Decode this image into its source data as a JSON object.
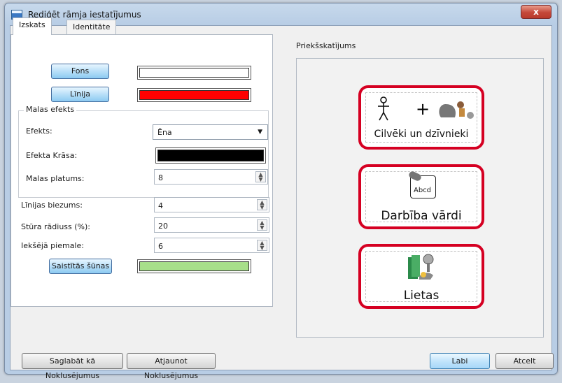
{
  "window": {
    "title": "Rediģēt rāmja iestatījumus",
    "close_label": "x"
  },
  "tabs": [
    {
      "label": "Izskats"
    },
    {
      "label": "Identitāte"
    }
  ],
  "appearance": {
    "fons_label": "Fons",
    "linija_label": "Līnija",
    "frame_color": "#ffffff",
    "line_color": "#ff0000",
    "effect_group_title": "Malas efekts",
    "effect_label": "Efekts:",
    "effect_value": "Ēna",
    "effect_color_label": "Efekta Krāsa:",
    "effect_color": "#000000",
    "edge_width_label": "Malas platums:",
    "edge_width_value": "8",
    "line_thickness_label": "Līnijas biezums:",
    "line_thickness_value": "4",
    "corner_radius_label": "Stūra rādiuss (%):",
    "corner_radius_value": "20",
    "inner_padding_label": "Iekšējā piemale:",
    "inner_padding_value": "6",
    "linked_cells_label": "Saistītās šūnas",
    "linked_cells_color": "#a7df8a"
  },
  "preview": {
    "title": "Priekšskatījums",
    "cards": [
      {
        "label": "Cilvēki un dzīvnieki"
      },
      {
        "label": "Darbība vārdi"
      },
      {
        "label": "Lietas"
      }
    ],
    "abcd_text": "Abcd"
  },
  "buttons": {
    "save_defaults": "Saglabāt kā Noklusējumus",
    "restore_defaults": "Atjaunot Noklusējumus",
    "ok": "Labi",
    "cancel": "Atcelt"
  }
}
